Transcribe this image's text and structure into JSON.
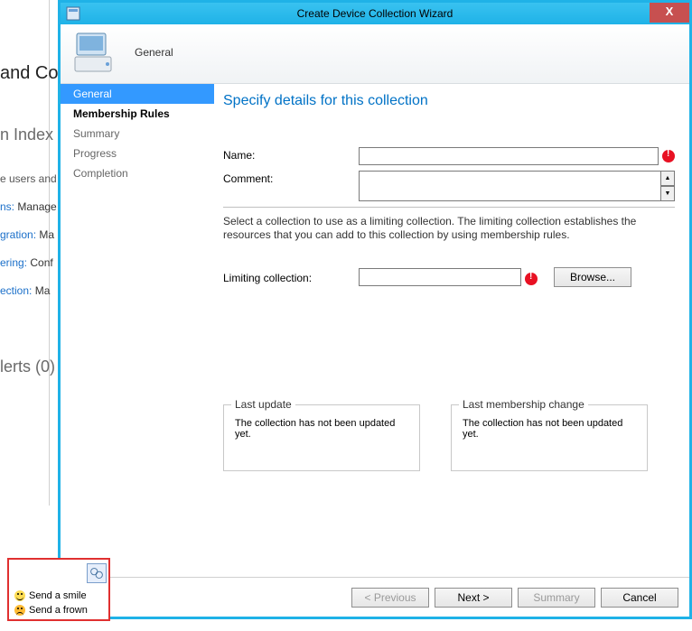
{
  "window": {
    "title": "Create Device Collection Wizard",
    "close": "X"
  },
  "header": {
    "label": "General"
  },
  "nav": {
    "items": [
      {
        "label": "General"
      },
      {
        "label": "Membership Rules"
      },
      {
        "label": "Summary"
      },
      {
        "label": "Progress"
      },
      {
        "label": "Completion"
      }
    ]
  },
  "content": {
    "section_title": "Specify details for this collection",
    "name_label": "Name:",
    "name_value": "",
    "comment_label": "Comment:",
    "comment_value": "",
    "limiting_help": "Select a collection to use as a limiting collection. The limiting collection establishes the resources that you can add to this collection by using membership rules.",
    "limiting_label": "Limiting collection:",
    "limiting_value": "",
    "browse_label": "Browse...",
    "last_update": {
      "legend": "Last update",
      "text": "The collection has not been updated yet."
    },
    "last_membership": {
      "legend": "Last membership change",
      "text": "The collection has not been updated yet."
    }
  },
  "buttons": {
    "previous": "< Previous",
    "next": "Next >",
    "summary": "Summary",
    "cancel": "Cancel"
  },
  "background": {
    "h1": "and Co",
    "h2": "n Index",
    "r1": "e users and",
    "r2a": "ns:",
    "r2b": " Manage",
    "r3a": "gration:",
    "r3b": " Ma",
    "r4a": "ering:",
    "r4b": " Conf",
    "r5a": "ection:",
    "r5b": " Ma",
    "alerts": "lerts (0)"
  },
  "feedback": {
    "smile": "Send a smile",
    "frown": "Send a frown"
  }
}
